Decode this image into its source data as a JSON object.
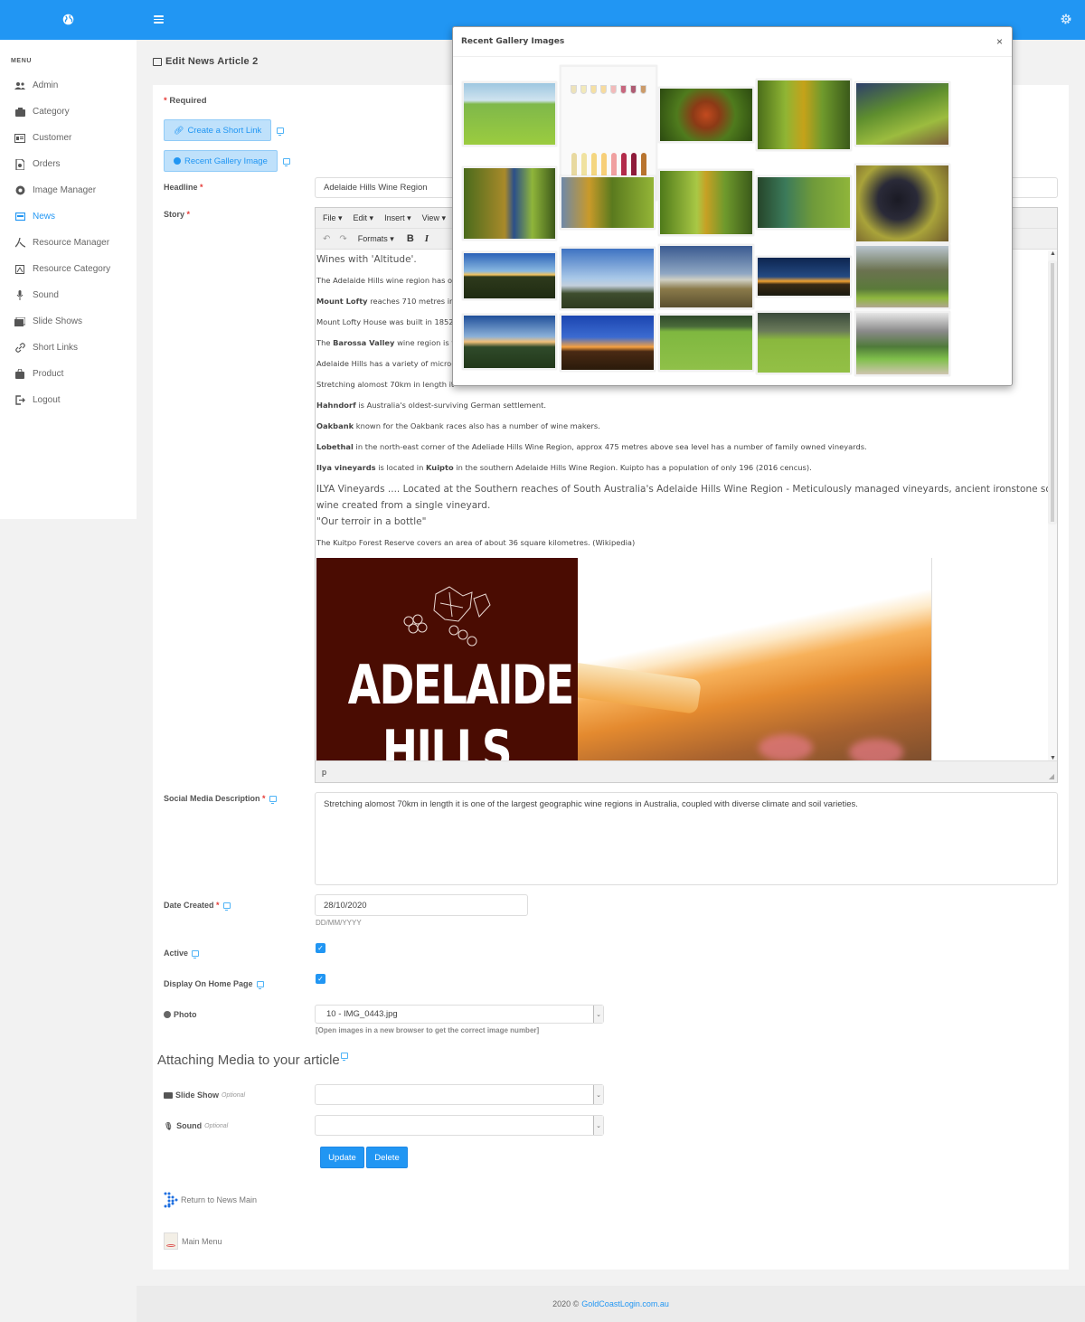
{
  "sidebar": {
    "menu_title": "MENU",
    "items": [
      {
        "label": "Admin",
        "icon": "users-icon"
      },
      {
        "label": "Category",
        "icon": "category-icon"
      },
      {
        "label": "Customer",
        "icon": "id-card-icon"
      },
      {
        "label": "Orders",
        "icon": "orders-icon"
      },
      {
        "label": "Image Manager",
        "icon": "aperture-icon"
      },
      {
        "label": "News",
        "icon": "news-icon",
        "active": true
      },
      {
        "label": "Resource Manager",
        "icon": "pdf-icon"
      },
      {
        "label": "Resource Category",
        "icon": "resource-category-icon"
      },
      {
        "label": "Sound",
        "icon": "microphone-icon"
      },
      {
        "label": "Slide Shows",
        "icon": "slideshow-icon"
      },
      {
        "label": "Short Links",
        "icon": "link-icon"
      },
      {
        "label": "Product",
        "icon": "bag-icon"
      },
      {
        "label": "Logout",
        "icon": "logout-icon"
      }
    ]
  },
  "page": {
    "title": "Edit News Article 2",
    "required_label": "Required",
    "required_mark": "*",
    "short_link_button": "Create a Short Link",
    "gallery_button": "Recent Gallery Image"
  },
  "form": {
    "headline_label": "Headline",
    "headline_value": "Adelaide Hills Wine Region",
    "story_label": "Story",
    "social_label": "Social Media Description",
    "social_value": "Stretching alomost 70km in length it is one of the largest geographic wine regions in Australia, coupled with diverse climate and soil varieties.",
    "date_label": "Date Created",
    "date_value": "28/10/2020",
    "date_format": "DD/MM/YYYY",
    "active_label": "Active",
    "active_checked": true,
    "home_label": "Display On Home Page",
    "home_checked": true,
    "photo_label": "Photo",
    "photo_value": "10 - IMG_0443.jpg",
    "photo_hint": "[Open images in a new browser to get the correct image number]",
    "media_heading": "Attaching Media to your article",
    "slideshow_label": "Slide Show",
    "sound_label": "Sound",
    "optional": "Optional",
    "slideshow_value": "",
    "sound_value": "",
    "update_button": "Update",
    "delete_button": "Delete",
    "return_link": "Return to News Main",
    "main_menu_link": "Main Menu"
  },
  "editor": {
    "menus": [
      "File ▾",
      "Edit ▾",
      "Insert ▾",
      "View ▾"
    ],
    "formats": "Formats ▾",
    "bold": "B",
    "italic": "I",
    "status_path": "p",
    "banner_text_1": "ADELAIDE",
    "banner_text_2": "HILLS",
    "paragraphs": [
      {
        "bold": "",
        "text": "Wines with 'Altitude'.",
        "large": true
      },
      {
        "bold": "",
        "text": "The Adelaide Hills wine region has ov"
      },
      {
        "bold": "Mount Lofty",
        "text": " reaches 710 metres in"
      },
      {
        "bold": "",
        "text": "Mount Lofty House was built in 1852"
      },
      {
        "pre": "The ",
        "bold": "Barossa Valley",
        "text": " wine region is to"
      },
      {
        "bold": "",
        "text": "Adelaide Hills has a variety of micro-c"
      },
      {
        "bold": "",
        "text": "Stretching alomost 70km in length it"
      },
      {
        "bold": "Hahndorf",
        "text": " is Australia's oldest-surviving German settlement."
      },
      {
        "bold": "Oakbank",
        "text": " known for the Oakbank races also has a number of wine makers."
      },
      {
        "bold": "Lobethal",
        "text": " in the north-east corner of the Adeliade Hills Wine Region, approx 475 metres above sea level has a number of family owned vineyards."
      },
      {
        "bold": "Ilya vineyards",
        "text": " is located in ",
        "bold2": "Kuipto",
        "text2": " in the southern Adelaide Hills Wine Region. Kuipto has a population of only 196 (2016 cencus)."
      },
      {
        "bold": "",
        "text": "ILYA Vineyards .... Located at the Southern reaches of South Australia's Adelaide Hills Wine Region - Meticulously managed vineyards, ancient ironstone soils, artisan",
        "large": true
      },
      {
        "bold": "",
        "text": "wine created from a single vineyard.",
        "large": true
      },
      {
        "bold": "",
        "text": "\"Our terroir in a bottle\"",
        "large": true
      },
      {
        "bold": "",
        "text": "The Kuitpo Forest Reserve covers an area of about 36 square kilometres. (Wikipedia)"
      }
    ]
  },
  "modal": {
    "title": "Recent Gallery Images",
    "close": "×",
    "images": [
      {
        "subject": "hillside-with-pot"
      },
      {
        "subject": "wine-glass-guide"
      },
      {
        "subject": "red-vine-leaf"
      },
      {
        "subject": "vineyard-harvester"
      },
      {
        "subject": "grape-vines"
      },
      {
        "subject": "harvester-worker"
      },
      {
        "subject": "harvester-machine"
      },
      {
        "subject": "vineyard-row"
      },
      {
        "subject": "harvest-bins"
      },
      {
        "subject": "black-grapes"
      },
      {
        "subject": "sunrise-field"
      },
      {
        "subject": "bare-tree-sunrise"
      },
      {
        "subject": "misty-paddock"
      },
      {
        "subject": "sunset-horizon"
      },
      {
        "subject": "tree-lined-path"
      },
      {
        "subject": "misty-dam"
      },
      {
        "subject": "sunrise-tree"
      },
      {
        "subject": "sheep-paddock"
      },
      {
        "subject": "sheep-gum-trees"
      },
      {
        "subject": "driveway-trees"
      }
    ]
  },
  "footer": {
    "year": "2020 ©",
    "link": "GoldCoastLogin.com.au"
  }
}
